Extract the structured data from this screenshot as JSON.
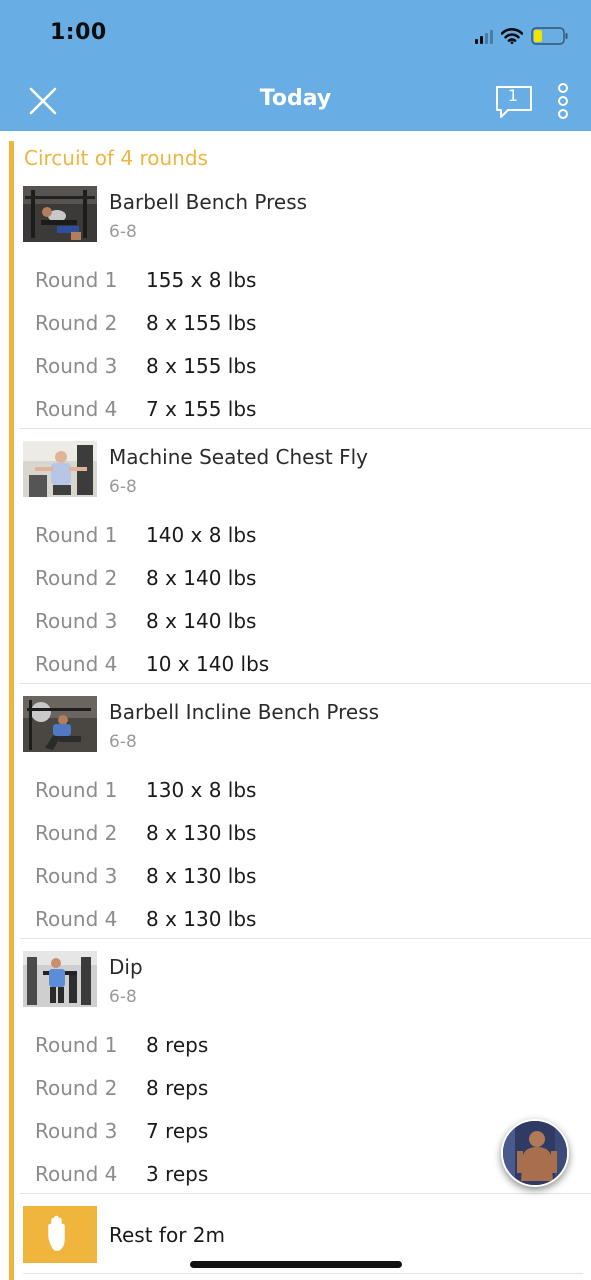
{
  "status_bar": {
    "time": "1:00"
  },
  "nav": {
    "title": "Today",
    "comment_count": "1"
  },
  "circuit": {
    "title": "Circuit of 4 rounds"
  },
  "exercises": [
    {
      "name": "Barbell Bench Press",
      "target": "6-8",
      "thumbnail_icon": "bench-press-photo",
      "rounds": [
        {
          "label": "Round 1",
          "value": "155 x 8 lbs"
        },
        {
          "label": "Round 2",
          "value": "8 x 155 lbs"
        },
        {
          "label": "Round 3",
          "value": "8 x 155 lbs"
        },
        {
          "label": "Round 4",
          "value": "7 x 155 lbs"
        }
      ]
    },
    {
      "name": "Machine Seated Chest Fly",
      "target": "6-8",
      "thumbnail_icon": "chest-fly-photo",
      "rounds": [
        {
          "label": "Round 1",
          "value": "140 x 8 lbs"
        },
        {
          "label": "Round 2",
          "value": "8 x 140 lbs"
        },
        {
          "label": "Round 3",
          "value": "8 x 140 lbs"
        },
        {
          "label": "Round 4",
          "value": "10 x 140 lbs"
        }
      ]
    },
    {
      "name": "Barbell Incline Bench Press",
      "target": "6-8",
      "thumbnail_icon": "incline-bench-photo",
      "rounds": [
        {
          "label": "Round 1",
          "value": "130 x 8 lbs"
        },
        {
          "label": "Round 2",
          "value": "8 x 130 lbs"
        },
        {
          "label": "Round 3",
          "value": "8 x 130 lbs"
        },
        {
          "label": "Round 4",
          "value": "8 x 130 lbs"
        }
      ]
    },
    {
      "name": "Dip",
      "target": "6-8",
      "thumbnail_icon": "dip-photo",
      "rounds": [
        {
          "label": "Round 1",
          "value": "8 reps"
        },
        {
          "label": "Round 2",
          "value": "8 reps"
        },
        {
          "label": "Round 3",
          "value": "7 reps"
        },
        {
          "label": "Round 4",
          "value": "3 reps"
        }
      ]
    }
  ],
  "rest": {
    "label": "Rest for 2m",
    "icon": "hand-icon"
  },
  "colors": {
    "header_bg": "#68ade4",
    "accent": "#f0b53d"
  }
}
